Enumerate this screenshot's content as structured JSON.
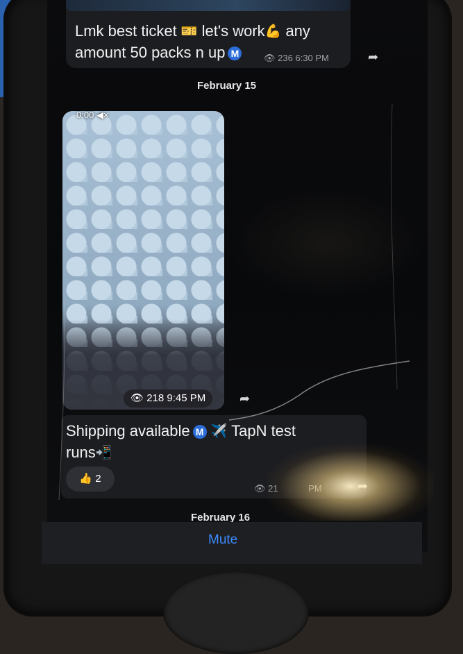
{
  "messages": [
    {
      "text_line1": "Lmk best ticket",
      "text_line1b": "let's work",
      "text_line1c": "any",
      "text_line2": "amount 50 packs n up",
      "badge": "M",
      "views": "236",
      "time": "6:30 PM",
      "emoji_ticket": "🎫",
      "emoji_muscle": "💪"
    },
    {
      "type": "video",
      "duration": "0:00",
      "mute_icon": "◀×",
      "views": "218",
      "time": "9:45 PM"
    },
    {
      "text_line1": "Shipping available",
      "badge": "M",
      "emoji_plane": "✈️",
      "text_line1b": "TapN test",
      "text_line2": "runs",
      "emoji_phone": "📲",
      "reaction_emoji": "👍",
      "reaction_count": "2",
      "views_partial": "21",
      "time_partial": "PM"
    }
  ],
  "dates": {
    "first": "February 15",
    "second": "February 16"
  },
  "bottom_bar": {
    "mute_label": "Mute"
  },
  "icons": {
    "eye": "👁",
    "share": "➦"
  },
  "colors": {
    "accent": "#3d8bff",
    "badge": "#2c6ed9",
    "bubble": "#1c1d21"
  }
}
